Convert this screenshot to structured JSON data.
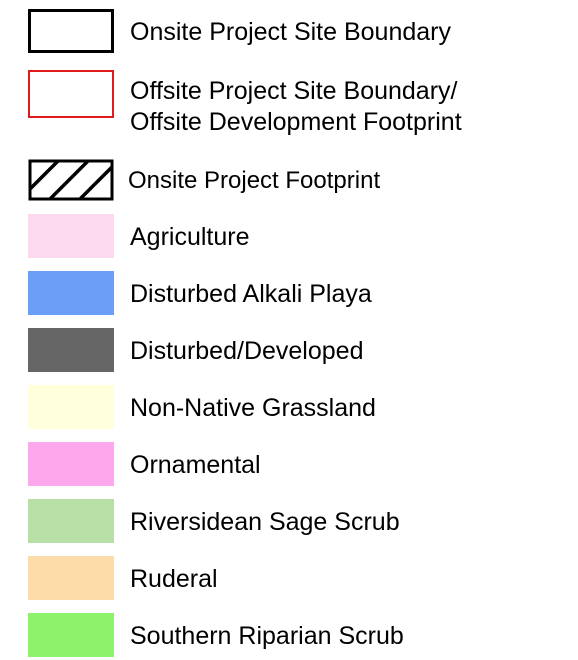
{
  "legend": {
    "items": [
      {
        "label": "Onsite Project Site Boundary",
        "kind": "outline",
        "color": "#000000"
      },
      {
        "label": "Offsite Project Site Boundary/\nOffsite Development Footprint",
        "kind": "outline",
        "color": "#e31a1c"
      },
      {
        "label": "Onsite Project Footprint",
        "kind": "hatch",
        "color": "#000000"
      },
      {
        "label": "Agriculture",
        "kind": "fill",
        "color": "#fdd9ef"
      },
      {
        "label": "Disturbed Alkali Playa",
        "kind": "fill",
        "color": "#6a9ff5"
      },
      {
        "label": "Disturbed/Developed",
        "kind": "fill",
        "color": "#666666"
      },
      {
        "label": "Non-Native Grassland",
        "kind": "fill",
        "color": "#ffffdb"
      },
      {
        "label": "Ornamental",
        "kind": "fill",
        "color": "#fda8ec"
      },
      {
        "label": "Riversidean Sage Scrub",
        "kind": "fill",
        "color": "#b8e0a6"
      },
      {
        "label": "Ruderal",
        "kind": "fill",
        "color": "#fedcaa"
      },
      {
        "label": "Southern Riparian Scrub",
        "kind": "fill",
        "color": "#8ef36a"
      }
    ]
  }
}
